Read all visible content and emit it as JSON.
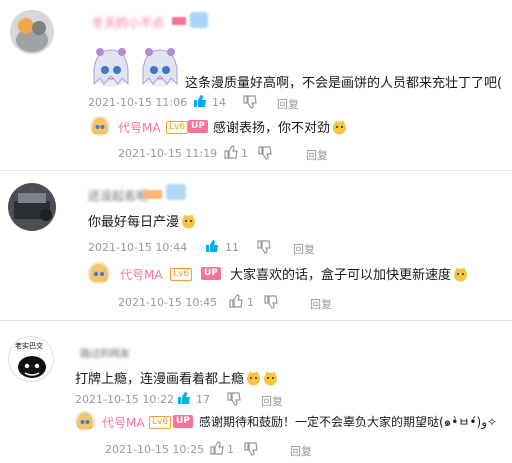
{
  "colors": {
    "accent_blue": "#00aeec",
    "up_pink": "#fb7299",
    "meta_gray": "#9499a0",
    "level_orange": "#ff9a2e"
  },
  "comments": [
    {
      "username": "冬天的小不点",
      "text": "这条漫质量好高啊，不会是画饼的人员都来充壮丁了吧(",
      "time": "2021-10-15 11:06",
      "likes": "14",
      "reply_label": "回复",
      "reply": {
        "username": "代号MA",
        "level": "Lv6",
        "up_badge": "UP",
        "text": "感谢表扬，你不对劲",
        "time": "2021-10-15 11:19",
        "likes": "1",
        "reply_label": "回复"
      }
    },
    {
      "username": "还没起名呢",
      "text": "你最好每日产漫",
      "time": "2021-10-15 10:44",
      "likes": "11",
      "reply_label": "回复",
      "reply": {
        "username": "代号MA",
        "level": "Lv6",
        "up_badge": "UP",
        "text": "大家喜欢的话，盒子可以加快更新速度",
        "time": "2021-10-15 10:45",
        "likes": "1",
        "reply_label": "回复"
      }
    },
    {
      "username": "路过的网友",
      "avatar_text": "老实巴交",
      "text": "打牌上瘾，连漫画看着都上瘾",
      "time": "2021-10-15 10:22",
      "likes": "17",
      "reply_label": "回复",
      "reply": {
        "username": "代号MA",
        "level": "Lv6",
        "up_badge": "UP",
        "text": "感谢期待和鼓励！一定不会辜负大家的期望哒(๑•̀ㅂ•́)و✧",
        "time": "2021-10-15 10:25",
        "likes": "1",
        "reply_label": "回复"
      }
    }
  ]
}
